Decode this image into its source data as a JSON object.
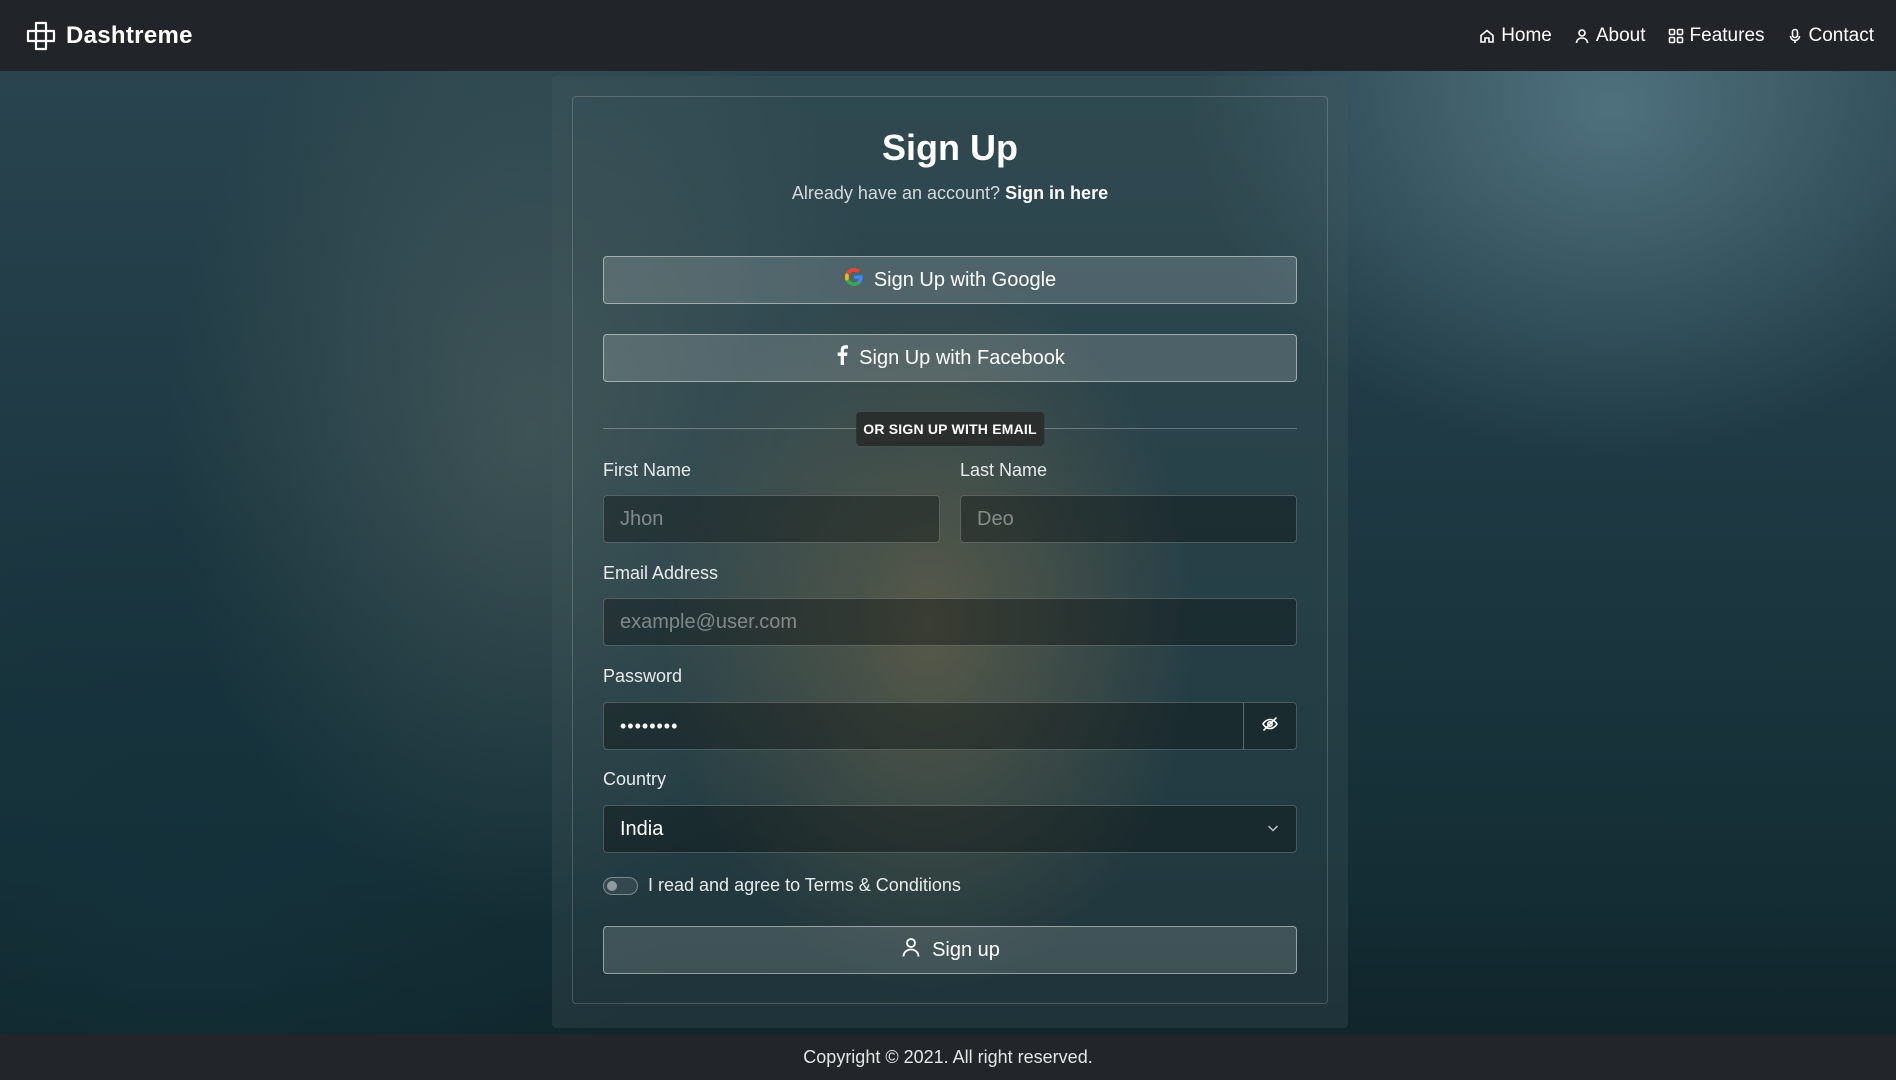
{
  "brand": {
    "name": "Dashtreme",
    "icon": "puzzle-cross-icon"
  },
  "nav": [
    {
      "label": "Home",
      "icon": "home-icon"
    },
    {
      "label": "About",
      "icon": "user-icon"
    },
    {
      "label": "Features",
      "icon": "grid-icon"
    },
    {
      "label": "Contact",
      "icon": "microphone-icon"
    }
  ],
  "form": {
    "title": "Sign Up",
    "subtitle_text": "Already have an account?",
    "signin_link": "Sign in here",
    "google_label": "Sign Up with Google",
    "facebook_label": "Sign Up with Facebook",
    "divider_label": "OR SIGN UP WITH EMAIL",
    "first_name": {
      "label": "First Name",
      "placeholder": "Jhon",
      "value": ""
    },
    "last_name": {
      "label": "Last Name",
      "placeholder": "Deo",
      "value": ""
    },
    "email": {
      "label": "Email Address",
      "placeholder": "example@user.com",
      "value": ""
    },
    "password": {
      "label": "Password",
      "value": "••••••••"
    },
    "country": {
      "label": "Country",
      "selected": "India"
    },
    "terms_label": "I read and agree to Terms & Conditions",
    "terms_checked": false,
    "submit_label": "Sign up"
  },
  "footer": {
    "text": "Copyright © 2021. All right reserved."
  },
  "colors": {
    "navbar": "#212529",
    "footer": "#22262a",
    "text": "#ffffff"
  }
}
